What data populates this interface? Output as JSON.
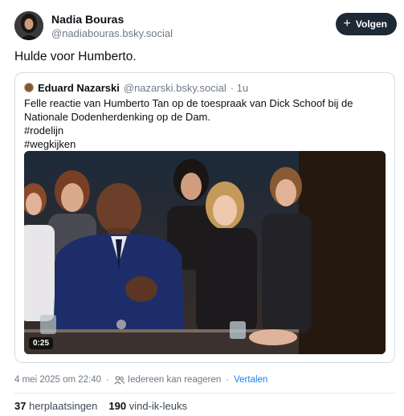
{
  "author": {
    "name": "Nadia Bouras",
    "handle": "@nadiabouras.bsky.social",
    "avatar_icon": "user-avatar"
  },
  "follow_button": {
    "label": "Volgen",
    "icon": "plus-icon"
  },
  "post": {
    "text": "Hulde voor Humberto."
  },
  "quote": {
    "author_name": "Eduard Nazarski",
    "author_handle": "@nazarski.bsky.social",
    "age": "· 1u",
    "lines": [
      "Felle reactie van Humberto Tan op de toespraak van Dick Schoof bij de",
      "Nationale Dodenherdenking op de Dam.",
      "#rodelijn",
      "#wegkijken"
    ],
    "video": {
      "duration": "0:25"
    }
  },
  "meta": {
    "timestamp": "4 mei 2025 om 22:40",
    "reply_setting": "Iedereen kan reageren",
    "reply_icon": "people-icon",
    "translate_link": "Vertalen",
    "separator": "·"
  },
  "stats": {
    "reposts_count": "37",
    "reposts_label": "herplaatsingen",
    "likes_count": "190",
    "likes_label": "vind-ik-leuks"
  },
  "colors": {
    "follow_bg": "#1e2936",
    "link": "#1083fe",
    "muted": "#6f7a86",
    "border": "#d4dbe2"
  }
}
